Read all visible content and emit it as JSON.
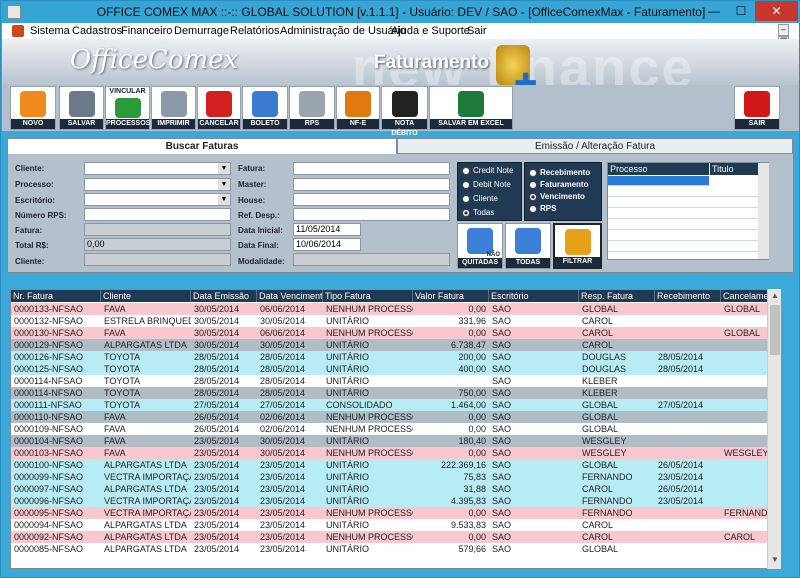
{
  "window": {
    "title": "OFFICE COMEX MAX ::-:: GLOBAL SOLUTION [v.1.1.1] - Usuário: DEV / SAO - [OfficeComexMax - Faturamento]",
    "min": "—",
    "max": "☐",
    "close": "✕"
  },
  "menu": [
    "Sistema",
    "Cadastros",
    "Financeiro",
    "Demurrage",
    "Relatórios",
    "Administração de Usuário",
    "Ajuda e Suporte",
    "Sair"
  ],
  "mdi": [
    "–",
    "❐",
    "✕"
  ],
  "header": {
    "logo": "OfficeComex",
    "section": "Faturamento",
    "watermark": "new finance"
  },
  "toolbar": [
    {
      "label": "NOVO",
      "icon": "new-document-icon",
      "color": "#f08a1c"
    },
    {
      "label": "SALVAR",
      "icon": "save-icon",
      "color": "#6a7a8a"
    },
    {
      "label": "PROCESSOS",
      "top": "VINCULAR",
      "icon": "link-process-icon",
      "color": "#2a9a3a"
    },
    {
      "label": "IMPRIMIR",
      "icon": "printer-icon",
      "color": "#8a9aa8"
    },
    {
      "label": "CANCELAR",
      "icon": "stop-hand-icon",
      "color": "#d02020"
    },
    {
      "label": "BOLETO",
      "icon": "boleto-icon",
      "color": "#3a7ad0"
    },
    {
      "label": "RPS",
      "icon": "rps-document-icon",
      "color": "#9aa5ae"
    },
    {
      "label": "NF-E",
      "icon": "nfe-icon",
      "color": "#e07a10"
    },
    {
      "label": "NOTA DÉBITO",
      "icon": "debit-note-icon",
      "color": "#222"
    },
    {
      "label": "SALVAR EM EXCEL",
      "icon": "excel-icon",
      "color": "#1e7a3a"
    },
    {
      "label": "SAIR",
      "icon": "exit-icon",
      "color": "#d01818"
    }
  ],
  "tabs": {
    "search": "Buscar Faturas",
    "edit": "Emissão / Alteração Fatura"
  },
  "form": {
    "cliente": "Cliente:",
    "processo": "Processo:",
    "escritorio": "Escritório:",
    "numero_rps": "Número RPS:",
    "fatura_l": "Fatura:",
    "total": "Total R$:",
    "total_val": "0,00",
    "cliente2": "Cliente:",
    "fatura": "Fatura:",
    "master": "Master:",
    "house": "House:",
    "ref_desp": "Ref. Desp.:",
    "data_inicial": "Data Inicial:",
    "data_inicial_val": "11/05/2014",
    "data_final": "Data Final:",
    "data_final_val": "10/06/2014",
    "modalidade": "Modalidade:"
  },
  "radios1": [
    {
      "label": "Credit Note",
      "on": false
    },
    {
      "label": "Debit Note",
      "on": false
    },
    {
      "label": "Cliente",
      "on": false
    },
    {
      "label": "Todas",
      "on": true
    }
  ],
  "radios2": [
    {
      "label": "Recebimento",
      "on": false
    },
    {
      "label": "Faturamento",
      "on": false
    },
    {
      "label": "Vencimento",
      "on": true
    },
    {
      "label": "RPS",
      "on": false
    }
  ],
  "buttons": {
    "nao": "NÃO",
    "quitadas": "QUITADAS",
    "todas": "TODAS",
    "filtrar": "FILTRAR"
  },
  "proc_headers": [
    "Processo",
    "Titulo"
  ],
  "columns": [
    "Nr. Fatura",
    "Cliente",
    "Data Emissão",
    "Data Vencimento",
    "Tipo Fatura",
    "Valor Fatura",
    "Escritório",
    "Resp. Fatura",
    "Recebimento",
    "Cancelamento"
  ],
  "row_colors": {
    "pink": "#f8c7cf",
    "white": "#ffffff",
    "gray": "#b0bcc6",
    "cyan": "#b7ecf4"
  },
  "rows": [
    [
      "0000133-NFSAO",
      "FAVA",
      "30/05/2014",
      "06/06/2014",
      "NENHUM PROCESSO",
      "0,00",
      "SAO",
      "GLOBAL",
      "",
      "GLOBAL",
      "pink"
    ],
    [
      "0000132-NFSAO",
      "ESTRELA BRINQUEDOS",
      "30/05/2014",
      "30/05/2014",
      "UNITÁRIO",
      "331,96",
      "SAO",
      "CAROL",
      "",
      "",
      "white"
    ],
    [
      "0000130-NFSAO",
      "FAVA",
      "30/05/2014",
      "06/06/2014",
      "NENHUM PROCESSO",
      "0,00",
      "SAO",
      "CAROL",
      "",
      "GLOBAL",
      "pink"
    ],
    [
      "0000129-NFSAO",
      "ALPARGATAS LTDA",
      "30/05/2014",
      "30/05/2014",
      "UNITÁRIO",
      "6.738,47",
      "SAO",
      "CAROL",
      "",
      "",
      "gray"
    ],
    [
      "0000126-NFSAO",
      "TOYOTA",
      "28/05/2014",
      "28/05/2014",
      "UNITÁRIO",
      "200,00",
      "SAO",
      "DOUGLAS",
      "28/05/2014",
      "",
      "cyan"
    ],
    [
      "0000125-NFSAO",
      "TOYOTA",
      "28/05/2014",
      "28/05/2014",
      "UNITÁRIO",
      "400,00",
      "SAO",
      "DOUGLAS",
      "28/05/2014",
      "",
      "cyan"
    ],
    [
      "0000114-NFSAO",
      "TOYOTA",
      "28/05/2014",
      "28/05/2014",
      "UNITÁRIO",
      "",
      "SAO",
      "KLEBER",
      "",
      "",
      "white"
    ],
    [
      "0000114-NFSAO",
      "TOYOTA",
      "28/05/2014",
      "28/05/2014",
      "UNITÁRIO",
      "750,00",
      "SAO",
      "KLEBER",
      "",
      "",
      "gray"
    ],
    [
      "0000111-NFSAO",
      "TOYOTA",
      "27/05/2014",
      "27/05/2014",
      "CONSOLIDADO",
      "1.464,00",
      "SAO",
      "GLOBAL",
      "27/05/2014",
      "",
      "cyan"
    ],
    [
      "0000110-NFSAO",
      "FAVA",
      "26/05/2014",
      "02/06/2014",
      "NENHUM PROCESSO",
      "0,00",
      "SAO",
      "GLOBAL",
      "",
      "",
      "gray"
    ],
    [
      "0000109-NFSAO",
      "FAVA",
      "26/05/2014",
      "02/06/2014",
      "NENHUM PROCESSO",
      "0,00",
      "SAO",
      "GLOBAL",
      "",
      "",
      "white"
    ],
    [
      "0000104-NFSAO",
      "FAVA",
      "23/05/2014",
      "30/05/2014",
      "UNITÁRIO",
      "180,40",
      "SAO",
      "WESGLEY",
      "",
      "",
      "gray"
    ],
    [
      "0000103-NFSAO",
      "FAVA",
      "23/05/2014",
      "30/05/2014",
      "NENHUM PROCESSO",
      "0,00",
      "SAO",
      "WESGLEY",
      "",
      "WESGLEY",
      "pink"
    ],
    [
      "0000100-NFSAO",
      "ALPARGATAS LTDA",
      "23/05/2014",
      "23/05/2014",
      "UNITÁRIO",
      "222.369,16",
      "SAO",
      "GLOBAL",
      "26/05/2014",
      "",
      "cyan"
    ],
    [
      "0000099-NFSAO",
      "VECTRA IMPORTAÇÃO",
      "23/05/2014",
      "23/05/2014",
      "UNITÁRIO",
      "75,83",
      "SAO",
      "FERNANDO",
      "23/05/2014",
      "",
      "cyan"
    ],
    [
      "0000097-NFSAO",
      "ALPARGATAS LTDA",
      "23/05/2014",
      "23/05/2014",
      "UNITÁRIO",
      "31,88",
      "SAO",
      "CAROL",
      "26/05/2014",
      "",
      "cyan"
    ],
    [
      "0000096-NFSAO",
      "VECTRA IMPORTAÇÃO",
      "23/05/2014",
      "23/05/2014",
      "UNITÁRIO",
      "4.395,83",
      "SAO",
      "FERNANDO",
      "23/05/2014",
      "",
      "cyan"
    ],
    [
      "0000095-NFSAO",
      "VECTRA IMPORTAÇÃO",
      "23/05/2014",
      "23/05/2014",
      "NENHUM PROCESSO",
      "0,00",
      "SAO",
      "FERNANDO",
      "",
      "FERNANDO",
      "pink"
    ],
    [
      "0000094-NFSAO",
      "ALPARGATAS LTDA",
      "23/05/2014",
      "23/05/2014",
      "UNITÁRIO",
      "9.533,83",
      "SAO",
      "CAROL",
      "",
      "",
      "white"
    ],
    [
      "0000092-NFSAO",
      "ALPARGATAS LTDA",
      "23/05/2014",
      "23/05/2014",
      "NENHUM PROCESSO",
      "0,00",
      "SAO",
      "CAROL",
      "",
      "CAROL",
      "pink"
    ],
    [
      "0000085-NFSAO",
      "ALPARGATAS LTDA",
      "23/05/2014",
      "23/05/2014",
      "UNITÁRIO",
      "579,66",
      "SAO",
      "GLOBAL",
      "",
      "",
      "white"
    ]
  ]
}
